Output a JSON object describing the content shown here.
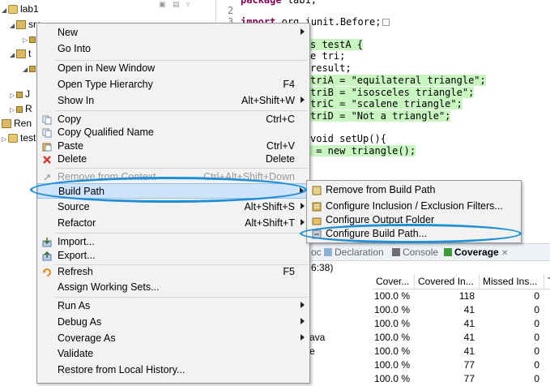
{
  "tree": {
    "project": "lab1",
    "node_src": "src",
    "node_t": "t",
    "node_j": "J",
    "node_r": "R",
    "node_ren": "Ren",
    "node_test": "test"
  },
  "editor": {
    "lines": [
      {
        "num": "2",
        "code": "package lab1;"
      },
      {
        "num": "3",
        "code": "import org.junit.Before;"
      },
      {
        "code": "s testA {"
      },
      {
        "code": "e tri;"
      },
      {
        "code": "result;"
      },
      {
        "code": "triA = \"equilateral triangle\";"
      },
      {
        "code": "triB = \"isosceles triangle\";"
      },
      {
        "code": "triC = \"scalene triangle\";"
      },
      {
        "code": "triD = \"Not a triangle\";"
      },
      {
        "code": "void setUp(){"
      },
      {
        "code": " = new triangle();"
      }
    ]
  },
  "context_menu": {
    "items": [
      {
        "label": "New"
      },
      {
        "label": "Go Into"
      },
      {
        "label": "Open in New Window"
      },
      {
        "label": "Open Type Hierarchy",
        "shortcut": "F4"
      },
      {
        "label": "Show In",
        "shortcut": "Alt+Shift+W"
      },
      {
        "label": "Copy",
        "shortcut": "Ctrl+C"
      },
      {
        "label": "Copy Qualified Name"
      },
      {
        "label": "Paste",
        "shortcut": "Ctrl+V"
      },
      {
        "label": "Delete",
        "shortcut": "Delete"
      },
      {
        "label": "Remove from Context",
        "shortcut": "Ctrl+Alt+Shift+Down"
      },
      {
        "label": "Build Path"
      },
      {
        "label": "Source",
        "shortcut": "Alt+Shift+S"
      },
      {
        "label": "Refactor",
        "shortcut": "Alt+Shift+T"
      },
      {
        "label": "Import..."
      },
      {
        "label": "Export..."
      },
      {
        "label": "Refresh",
        "shortcut": "F5"
      },
      {
        "label": "Assign Working Sets..."
      },
      {
        "label": "Run As"
      },
      {
        "label": "Debug As"
      },
      {
        "label": "Coverage As"
      },
      {
        "label": "Validate"
      },
      {
        "label": "Restore from Local History..."
      }
    ]
  },
  "submenu": {
    "items": [
      {
        "label": "Remove from Build Path"
      },
      {
        "label": "Configure Inclusion / Exclusion Filters..."
      },
      {
        "label": "Configure Output Folder"
      },
      {
        "label": "Configure Build Path..."
      }
    ]
  },
  "views": {
    "tabs": [
      "oc",
      "Declaration",
      "Console",
      "Coverage"
    ],
    "session": "6:38)"
  },
  "coverage": {
    "headers": [
      "Cover...",
      "Covered In...",
      "Missed Ins...",
      "T"
    ],
    "row_text": [
      "",
      "",
      "",
      "ava",
      "e",
      "",
      ""
    ],
    "rows": [
      [
        "100.0 %",
        "118",
        "0"
      ],
      [
        "100.0 %",
        "41",
        "0"
      ],
      [
        "100.0 %",
        "41",
        "0"
      ],
      [
        "100.0 %",
        "41",
        "0"
      ],
      [
        "100.0 %",
        "41",
        "0"
      ],
      [
        "100.0 %",
        "77",
        "0"
      ],
      [
        "100.0 %",
        "77",
        "0"
      ]
    ]
  },
  "colors": {
    "highlight_green": "#c8f5c0",
    "menu_hover": "#cfe3fb",
    "annotation": "#1f8fd6"
  }
}
